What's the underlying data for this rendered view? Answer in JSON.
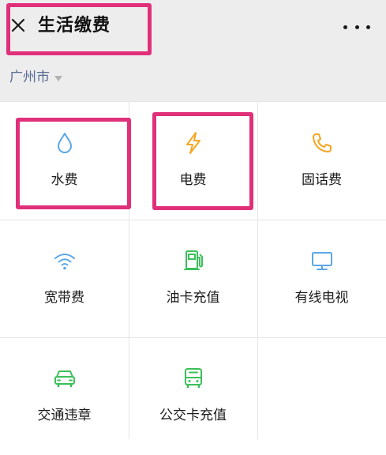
{
  "header": {
    "close_icon": "close-icon",
    "title": "生活缴费",
    "more_icon": "more-icon"
  },
  "city": {
    "name": "广州市",
    "dropdown_icon": "caret-down-icon"
  },
  "services": [
    {
      "label": "水费",
      "icon": "water-drop-icon",
      "color": "#5aa7e8"
    },
    {
      "label": "电费",
      "icon": "lightning-icon",
      "color": "#f5a623"
    },
    {
      "label": "固话费",
      "icon": "phone-icon",
      "color": "#f5a623"
    },
    {
      "label": "宽带费",
      "icon": "wifi-icon",
      "color": "#5aa7e8"
    },
    {
      "label": "油卡充值",
      "icon": "fuel-pump-icon",
      "color": "#3cc05a"
    },
    {
      "label": "有线电视",
      "icon": "tv-icon",
      "color": "#5aa7e8"
    },
    {
      "label": "交通违章",
      "icon": "car-icon",
      "color": "#3cc05a"
    },
    {
      "label": "公交卡充值",
      "icon": "bus-icon",
      "color": "#3cc05a"
    }
  ],
  "colors": {
    "header_bg": "#ededed",
    "city_text": "#576b95",
    "highlight": "#e0307a",
    "grid_line": "#e5e5e5"
  }
}
